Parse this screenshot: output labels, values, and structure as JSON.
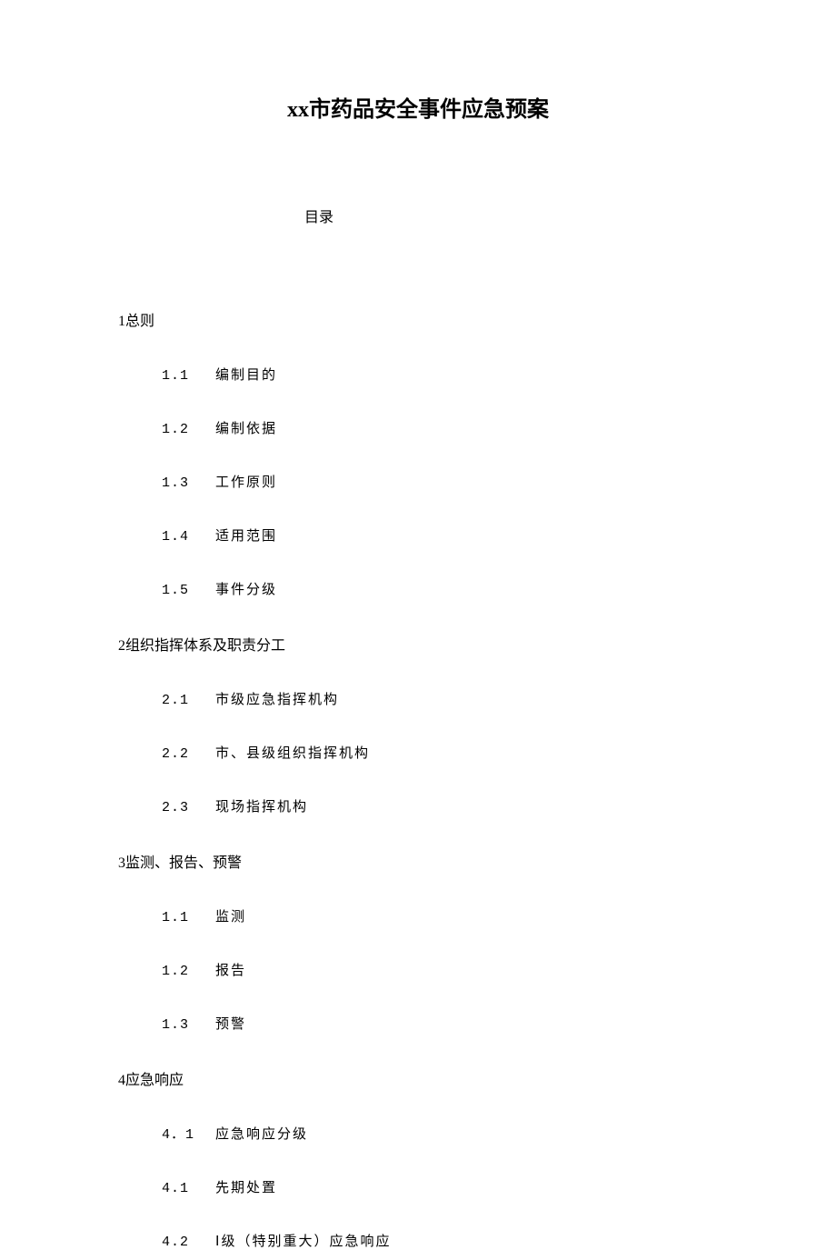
{
  "title": "xx市药品安全事件应急预案",
  "subtitle": "目录",
  "sections": [
    {
      "header": "1总则",
      "items": [
        {
          "num": "1.1",
          "text": "编制目的"
        },
        {
          "num": "1.2",
          "text": "编制依据"
        },
        {
          "num": "1.3",
          "text": "工作原则"
        },
        {
          "num": "1.4",
          "text": "适用范围"
        },
        {
          "num": "1.5",
          "text": "事件分级"
        }
      ]
    },
    {
      "header": "2组织指挥体系及职责分工",
      "items": [
        {
          "num": "2.1",
          "text": "市级应急指挥机构"
        },
        {
          "num": "2.2",
          "text": "市、县级组织指挥机构"
        },
        {
          "num": "2.3",
          "text": "现场指挥机构"
        }
      ]
    },
    {
      "header": "3监测、报告、预警",
      "items": [
        {
          "num": "1.1",
          "text": "监测"
        },
        {
          "num": "1.2",
          "text": "报告"
        },
        {
          "num": "1.3",
          "text": "预警"
        }
      ]
    },
    {
      "header": "4应急响应",
      "items": [
        {
          "num": "4．1",
          "text": "应急响应分级"
        },
        {
          "num": "4.1",
          "text": "先期处置"
        },
        {
          "num": "4.2",
          "text": "Ⅰ级（特别重大）应急响应"
        }
      ]
    }
  ]
}
